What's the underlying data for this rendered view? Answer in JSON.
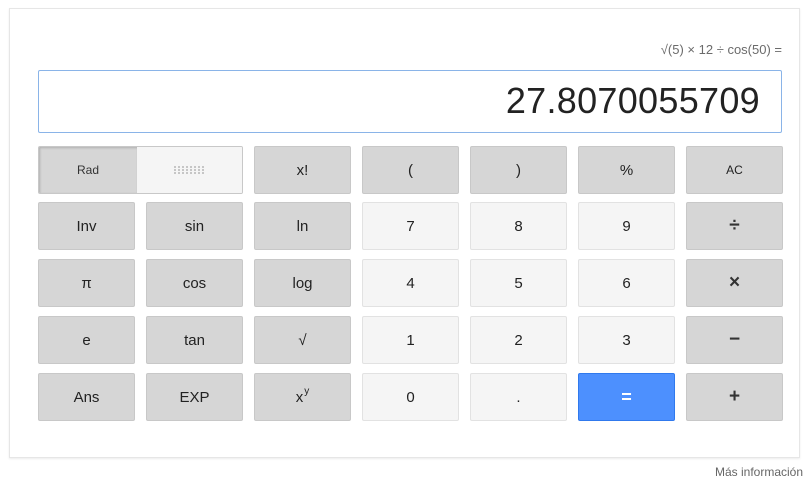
{
  "calculator": {
    "expression": "√(5) × 12 ÷ cos(50) =",
    "result": "27.8070055709",
    "mode_label": "Rad",
    "colors": {
      "equals_bg": "#4d90fe",
      "function_bg": "#d6d6d6",
      "digit_bg": "#f5f5f5",
      "display_border": "#8ab4e8"
    },
    "buttons": {
      "factorial": "x!",
      "open_paren": "(",
      "close_paren": ")",
      "percent": "%",
      "clear": "AC",
      "inv": "Inv",
      "sin": "sin",
      "ln": "ln",
      "seven": "7",
      "eight": "8",
      "nine": "9",
      "divide": "÷",
      "pi": "π",
      "cos": "cos",
      "log": "log",
      "four": "4",
      "five": "5",
      "six": "6",
      "multiply": "×",
      "e": "e",
      "tan": "tan",
      "sqrt": "√",
      "one": "1",
      "two": "2",
      "three": "3",
      "minus": "−",
      "ans": "Ans",
      "exp": "EXP",
      "power_base": "x",
      "power_sup": "y",
      "zero": "0",
      "decimal": ".",
      "equals": "=",
      "plus": "+"
    }
  },
  "footer": {
    "more_info": "Más información"
  }
}
